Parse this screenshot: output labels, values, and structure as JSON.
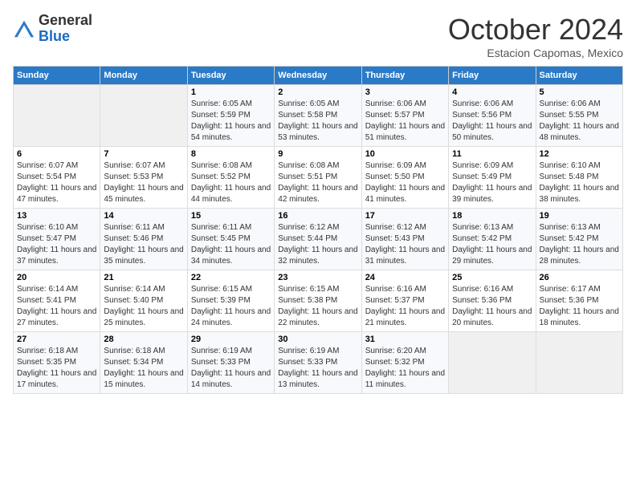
{
  "header": {
    "logo_general": "General",
    "logo_blue": "Blue",
    "month_title": "October 2024",
    "subtitle": "Estacion Capomas, Mexico"
  },
  "columns": [
    "Sunday",
    "Monday",
    "Tuesday",
    "Wednesday",
    "Thursday",
    "Friday",
    "Saturday"
  ],
  "weeks": [
    [
      {
        "num": "",
        "info": ""
      },
      {
        "num": "",
        "info": ""
      },
      {
        "num": "1",
        "info": "Sunrise: 6:05 AM\nSunset: 5:59 PM\nDaylight: 11 hours and 54 minutes."
      },
      {
        "num": "2",
        "info": "Sunrise: 6:05 AM\nSunset: 5:58 PM\nDaylight: 11 hours and 53 minutes."
      },
      {
        "num": "3",
        "info": "Sunrise: 6:06 AM\nSunset: 5:57 PM\nDaylight: 11 hours and 51 minutes."
      },
      {
        "num": "4",
        "info": "Sunrise: 6:06 AM\nSunset: 5:56 PM\nDaylight: 11 hours and 50 minutes."
      },
      {
        "num": "5",
        "info": "Sunrise: 6:06 AM\nSunset: 5:55 PM\nDaylight: 11 hours and 48 minutes."
      }
    ],
    [
      {
        "num": "6",
        "info": "Sunrise: 6:07 AM\nSunset: 5:54 PM\nDaylight: 11 hours and 47 minutes."
      },
      {
        "num": "7",
        "info": "Sunrise: 6:07 AM\nSunset: 5:53 PM\nDaylight: 11 hours and 45 minutes."
      },
      {
        "num": "8",
        "info": "Sunrise: 6:08 AM\nSunset: 5:52 PM\nDaylight: 11 hours and 44 minutes."
      },
      {
        "num": "9",
        "info": "Sunrise: 6:08 AM\nSunset: 5:51 PM\nDaylight: 11 hours and 42 minutes."
      },
      {
        "num": "10",
        "info": "Sunrise: 6:09 AM\nSunset: 5:50 PM\nDaylight: 11 hours and 41 minutes."
      },
      {
        "num": "11",
        "info": "Sunrise: 6:09 AM\nSunset: 5:49 PM\nDaylight: 11 hours and 39 minutes."
      },
      {
        "num": "12",
        "info": "Sunrise: 6:10 AM\nSunset: 5:48 PM\nDaylight: 11 hours and 38 minutes."
      }
    ],
    [
      {
        "num": "13",
        "info": "Sunrise: 6:10 AM\nSunset: 5:47 PM\nDaylight: 11 hours and 37 minutes."
      },
      {
        "num": "14",
        "info": "Sunrise: 6:11 AM\nSunset: 5:46 PM\nDaylight: 11 hours and 35 minutes."
      },
      {
        "num": "15",
        "info": "Sunrise: 6:11 AM\nSunset: 5:45 PM\nDaylight: 11 hours and 34 minutes."
      },
      {
        "num": "16",
        "info": "Sunrise: 6:12 AM\nSunset: 5:44 PM\nDaylight: 11 hours and 32 minutes."
      },
      {
        "num": "17",
        "info": "Sunrise: 6:12 AM\nSunset: 5:43 PM\nDaylight: 11 hours and 31 minutes."
      },
      {
        "num": "18",
        "info": "Sunrise: 6:13 AM\nSunset: 5:42 PM\nDaylight: 11 hours and 29 minutes."
      },
      {
        "num": "19",
        "info": "Sunrise: 6:13 AM\nSunset: 5:42 PM\nDaylight: 11 hours and 28 minutes."
      }
    ],
    [
      {
        "num": "20",
        "info": "Sunrise: 6:14 AM\nSunset: 5:41 PM\nDaylight: 11 hours and 27 minutes."
      },
      {
        "num": "21",
        "info": "Sunrise: 6:14 AM\nSunset: 5:40 PM\nDaylight: 11 hours and 25 minutes."
      },
      {
        "num": "22",
        "info": "Sunrise: 6:15 AM\nSunset: 5:39 PM\nDaylight: 11 hours and 24 minutes."
      },
      {
        "num": "23",
        "info": "Sunrise: 6:15 AM\nSunset: 5:38 PM\nDaylight: 11 hours and 22 minutes."
      },
      {
        "num": "24",
        "info": "Sunrise: 6:16 AM\nSunset: 5:37 PM\nDaylight: 11 hours and 21 minutes."
      },
      {
        "num": "25",
        "info": "Sunrise: 6:16 AM\nSunset: 5:36 PM\nDaylight: 11 hours and 20 minutes."
      },
      {
        "num": "26",
        "info": "Sunrise: 6:17 AM\nSunset: 5:36 PM\nDaylight: 11 hours and 18 minutes."
      }
    ],
    [
      {
        "num": "27",
        "info": "Sunrise: 6:18 AM\nSunset: 5:35 PM\nDaylight: 11 hours and 17 minutes."
      },
      {
        "num": "28",
        "info": "Sunrise: 6:18 AM\nSunset: 5:34 PM\nDaylight: 11 hours and 15 minutes."
      },
      {
        "num": "29",
        "info": "Sunrise: 6:19 AM\nSunset: 5:33 PM\nDaylight: 11 hours and 14 minutes."
      },
      {
        "num": "30",
        "info": "Sunrise: 6:19 AM\nSunset: 5:33 PM\nDaylight: 11 hours and 13 minutes."
      },
      {
        "num": "31",
        "info": "Sunrise: 6:20 AM\nSunset: 5:32 PM\nDaylight: 11 hours and 11 minutes."
      },
      {
        "num": "",
        "info": ""
      },
      {
        "num": "",
        "info": ""
      }
    ]
  ]
}
